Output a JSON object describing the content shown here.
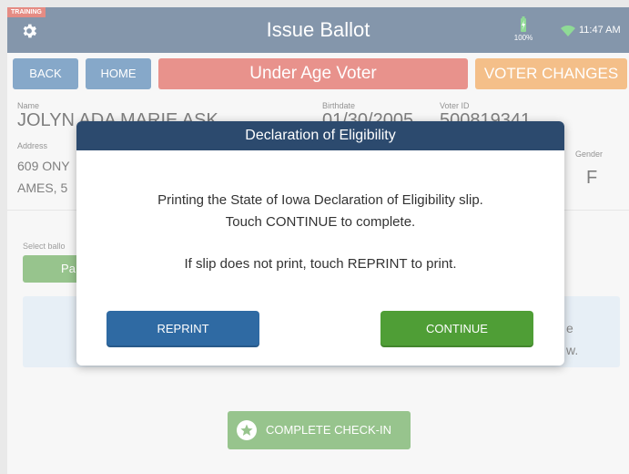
{
  "header": {
    "training_badge": "TRAINING",
    "title": "Issue Ballot",
    "battery": "100%",
    "time": "11:47 AM",
    "colors": {
      "bar": "#2c4a6e",
      "battery": "#3fbf4a",
      "wifi": "#3fbf4a"
    }
  },
  "actions": {
    "back": "BACK",
    "home": "HOME",
    "status": "Under Age Voter",
    "voter_changes": "VOTER CHANGES"
  },
  "voter": {
    "name_label": "Name",
    "name": "JOLYN ADA MARIE ASK",
    "birthdate_label": "Birthdate",
    "birthdate": "01/30/2005",
    "voter_id_label": "Voter ID",
    "voter_id": "500819341",
    "address_label": "Address",
    "address_line1": "609 ONY",
    "address_line2": "AMES, 5",
    "gender_label": "Gender",
    "gender": "F"
  },
  "ballot": {
    "select_label": "Select ballo",
    "party_button": "Pa",
    "info_line1": "e",
    "info_line2": "w."
  },
  "complete_checkin": "COMPLETE CHECK-IN",
  "modal": {
    "title": "Declaration of Eligibility",
    "line1": "Printing the State of Iowa Declaration of Eligibility slip.",
    "line2": "Touch CONTINUE to complete.",
    "line3": "If slip does not print, touch REPRINT to print.",
    "reprint": "REPRINT",
    "continue": "CONTINUE"
  }
}
